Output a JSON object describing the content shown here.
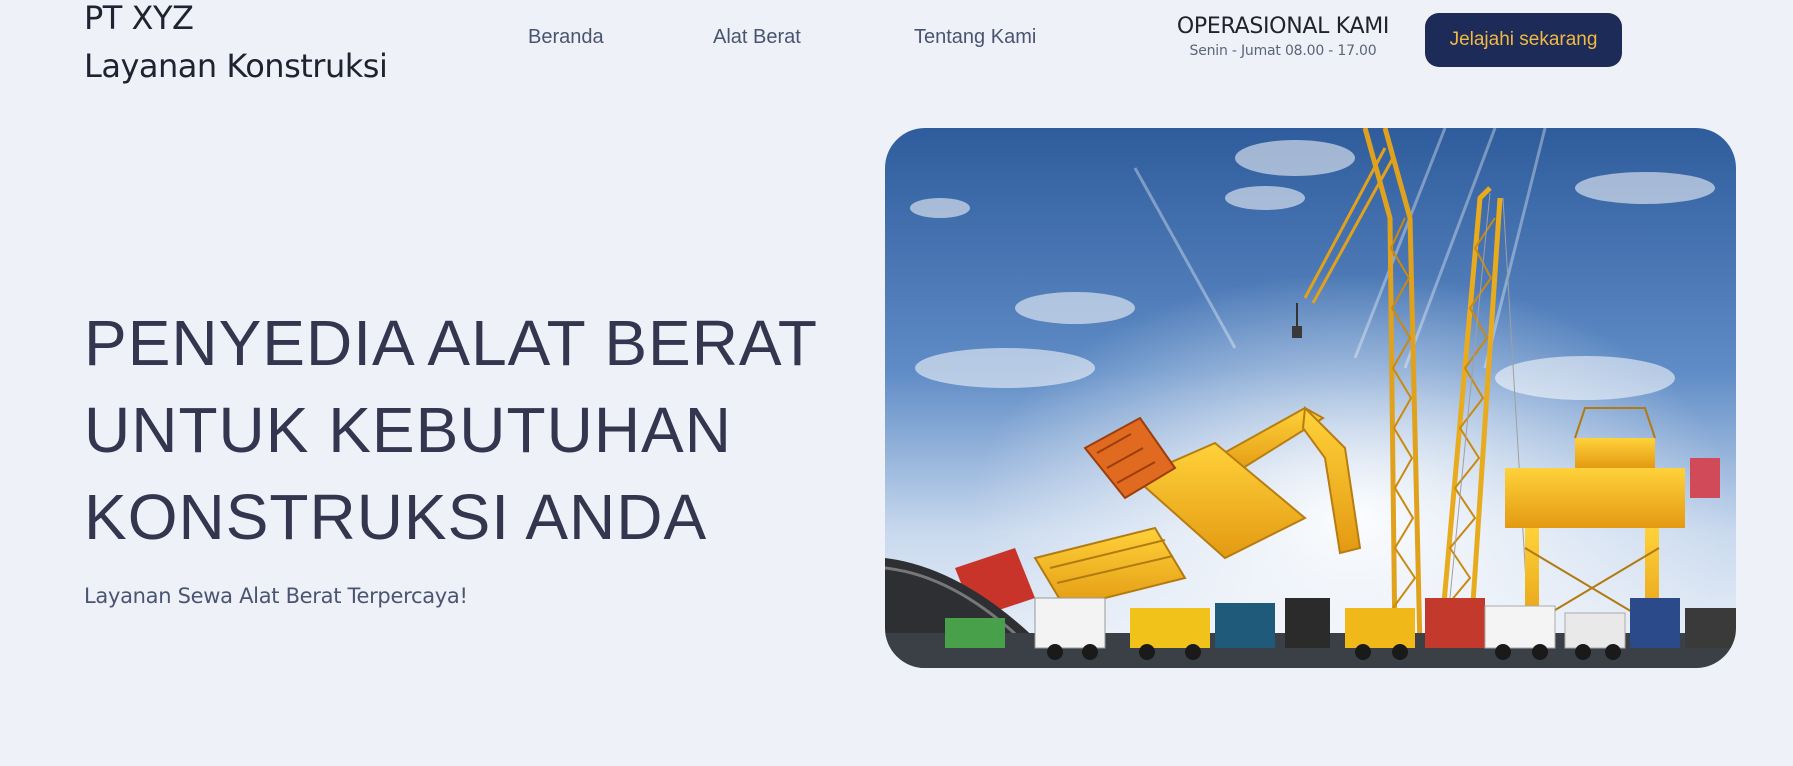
{
  "brand": {
    "line1": "PT XYZ",
    "line2": "Layanan Konstruksi"
  },
  "nav": {
    "items": [
      {
        "label": "Beranda"
      },
      {
        "label": "Alat Berat"
      },
      {
        "label": "Tentang Kami"
      }
    ]
  },
  "operations": {
    "title": "OPERASIONAL KAMI",
    "hours": "Senin - Jumat 08.00 - 17.00"
  },
  "cta": {
    "label": "Jelajahi sekarang"
  },
  "hero": {
    "headline": [
      "PENYEDIA ALAT BERAT",
      "UNTUK KEBUTUHAN",
      "KONSTRUKSI ANDA"
    ],
    "subtitle": "Layanan Sewa Alat Berat Terpercaya!"
  },
  "colors": {
    "background": "#eef1f8",
    "cta_background": "#1d2b58",
    "cta_text": "#f2b844",
    "headline": "#34354f"
  }
}
